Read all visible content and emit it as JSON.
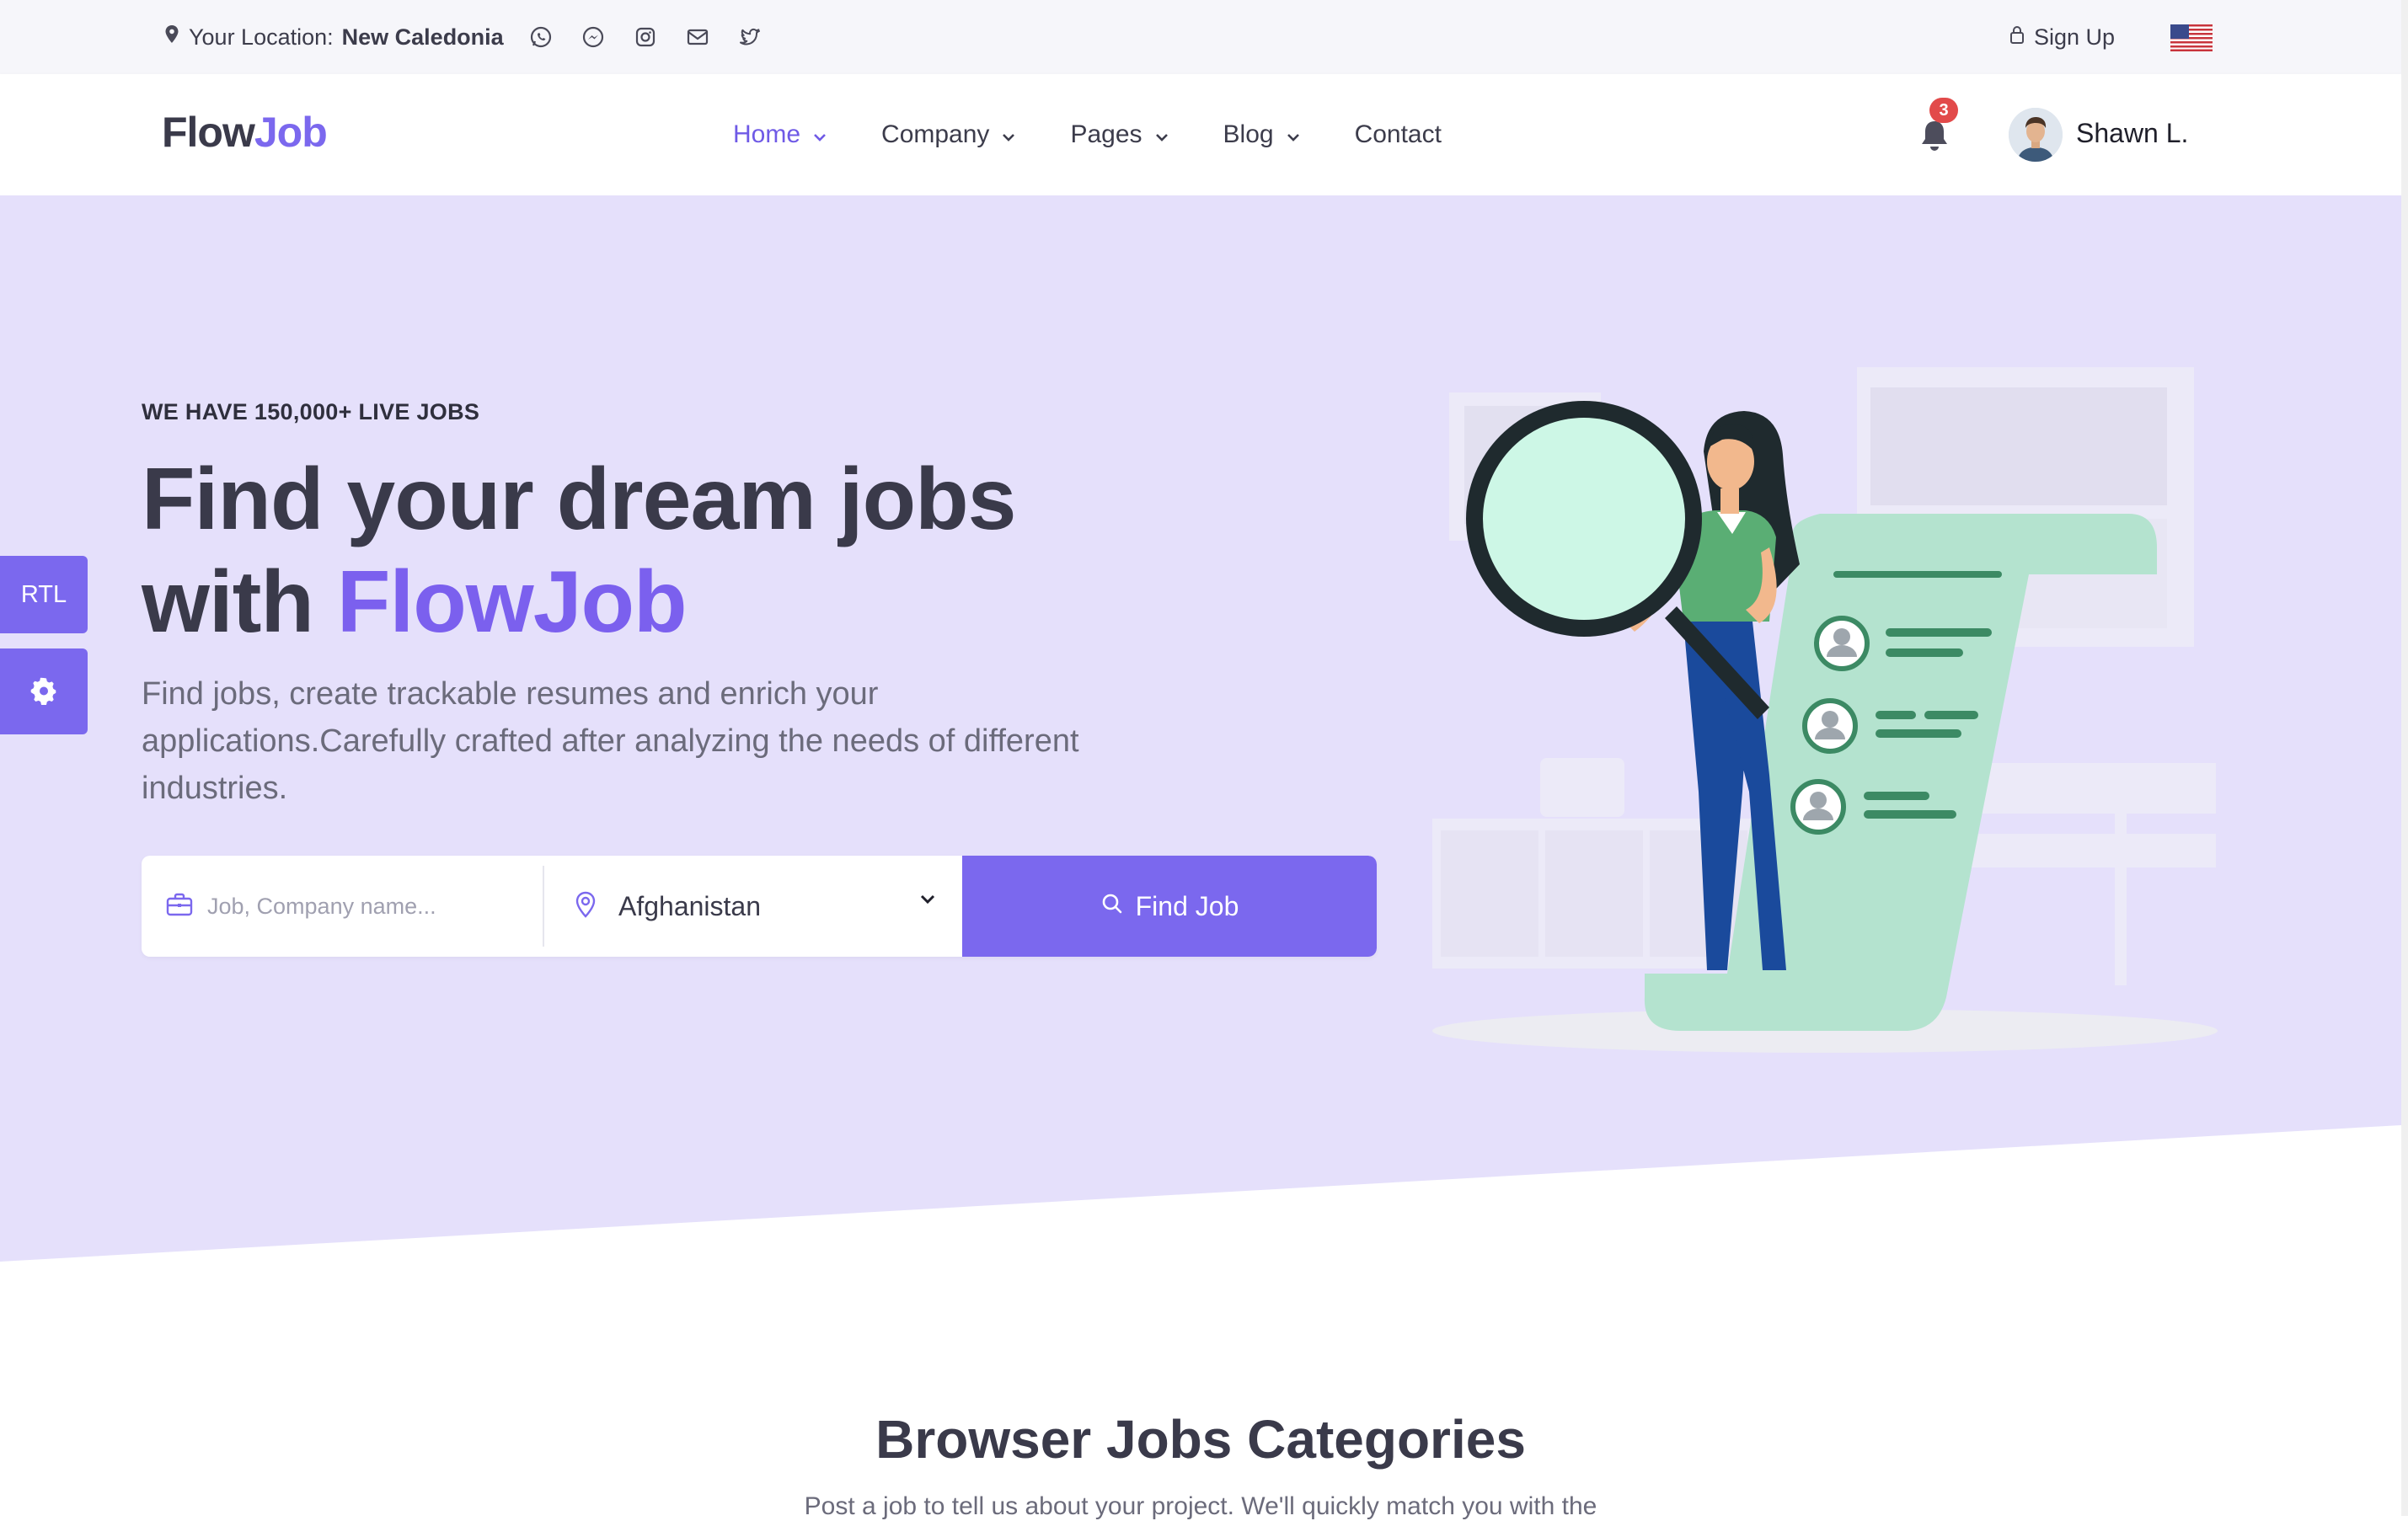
{
  "topbar": {
    "location_label": "Your Location:",
    "location_value": "New Caledonia",
    "social_icons": [
      "whatsapp-icon",
      "messenger-icon",
      "instagram-icon",
      "mail-icon",
      "twitter-icon"
    ],
    "signup_label": "Sign Up",
    "language_flag": "us-flag-icon"
  },
  "nav": {
    "logo_part1": "Flow",
    "logo_part2": "Job",
    "items": [
      {
        "label": "Home",
        "dropdown": true,
        "active": true
      },
      {
        "label": "Company",
        "dropdown": true,
        "active": false
      },
      {
        "label": "Pages",
        "dropdown": true,
        "active": false
      },
      {
        "label": "Blog",
        "dropdown": true,
        "active": false
      },
      {
        "label": "Contact",
        "dropdown": false,
        "active": false
      }
    ],
    "notification_count": "3",
    "user_name": "Shawn L."
  },
  "hero": {
    "eyebrow": "WE HAVE 150,000+ LIVE JOBS",
    "headline_line1": "Find your dream jobs",
    "headline_with": "with ",
    "headline_brand": "FlowJob",
    "subtitle": "Find jobs, create trackable resumes and enrich your applications.Carefully crafted after analyzing the needs of different industries.",
    "search": {
      "keyword_placeholder": "Job, Company name...",
      "location_value": "Afghanistan",
      "button_label": "Find Job"
    }
  },
  "side_tabs": {
    "rtl_label": "RTL"
  },
  "categories": {
    "title": "Browser Jobs Categories",
    "subtitle": "Post a job to tell us about your project. We'll quickly match you with the"
  },
  "colors": {
    "accent": "#7b68ee",
    "hero_bg": "#e5e0fb",
    "badge": "#e24a4a",
    "mint": "#b4e3cf"
  }
}
